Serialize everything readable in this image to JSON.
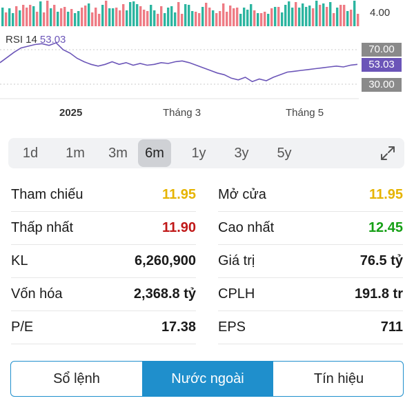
{
  "chart": {
    "price_label": "4.00",
    "rsi_name": "RSI 14",
    "rsi_value": "53.03",
    "rsi_upper": "70.00",
    "rsi_lower": "30.00",
    "x_labels": [
      "2025",
      "Tháng 3",
      "Tháng 5"
    ],
    "rsi_series": [
      55,
      61,
      67,
      72,
      74,
      76,
      77,
      75,
      78,
      70,
      66,
      60,
      56,
      53,
      51,
      53,
      56,
      53,
      55,
      52,
      54,
      52,
      53,
      55,
      54,
      56,
      57,
      55,
      52,
      49,
      46,
      43,
      41,
      37,
      35,
      38,
      33,
      36,
      34,
      38,
      41,
      44,
      45,
      46,
      47,
      48,
      49,
      50,
      51,
      50,
      52,
      53
    ],
    "colors": {
      "up": "#2cb5a0",
      "down": "#ee7b84",
      "rsi": "#6b55b8",
      "neutral": "#8a8a8a"
    }
  },
  "timeframes": {
    "items": [
      "1d",
      "1m",
      "3m",
      "6m",
      "1y",
      "3y",
      "5y"
    ],
    "active": "6m",
    "expand_icon": "expand-icon"
  },
  "stats": {
    "left": [
      {
        "label": "Tham chiếu",
        "value": "11.95",
        "color": "#e6b400"
      },
      {
        "label": "Thấp nhất",
        "value": "11.90",
        "color": "#c01818"
      },
      {
        "label": "KL",
        "value": "6,260,900",
        "color": "#1a1a1a"
      },
      {
        "label": "Vốn hóa",
        "value": "2,368.8 tỷ",
        "color": "#1a1a1a"
      },
      {
        "label": "P/E",
        "value": "17.38",
        "color": "#1a1a1a"
      }
    ],
    "right": [
      {
        "label": "Mở cửa",
        "value": "11.95",
        "color": "#e6b400"
      },
      {
        "label": "Cao nhất",
        "value": "12.45",
        "color": "#16a016"
      },
      {
        "label": "Giá trị",
        "value": "76.5 tỷ",
        "color": "#1a1a1a"
      },
      {
        "label": "CPLH",
        "value": "191.8 tr",
        "color": "#1a1a1a"
      },
      {
        "label": "EPS",
        "value": "711",
        "color": "#1a1a1a"
      }
    ]
  },
  "tabs": {
    "items": [
      "Sổ lệnh",
      "Nước ngoài",
      "Tín hiệu"
    ],
    "active": "Nước ngoài"
  }
}
